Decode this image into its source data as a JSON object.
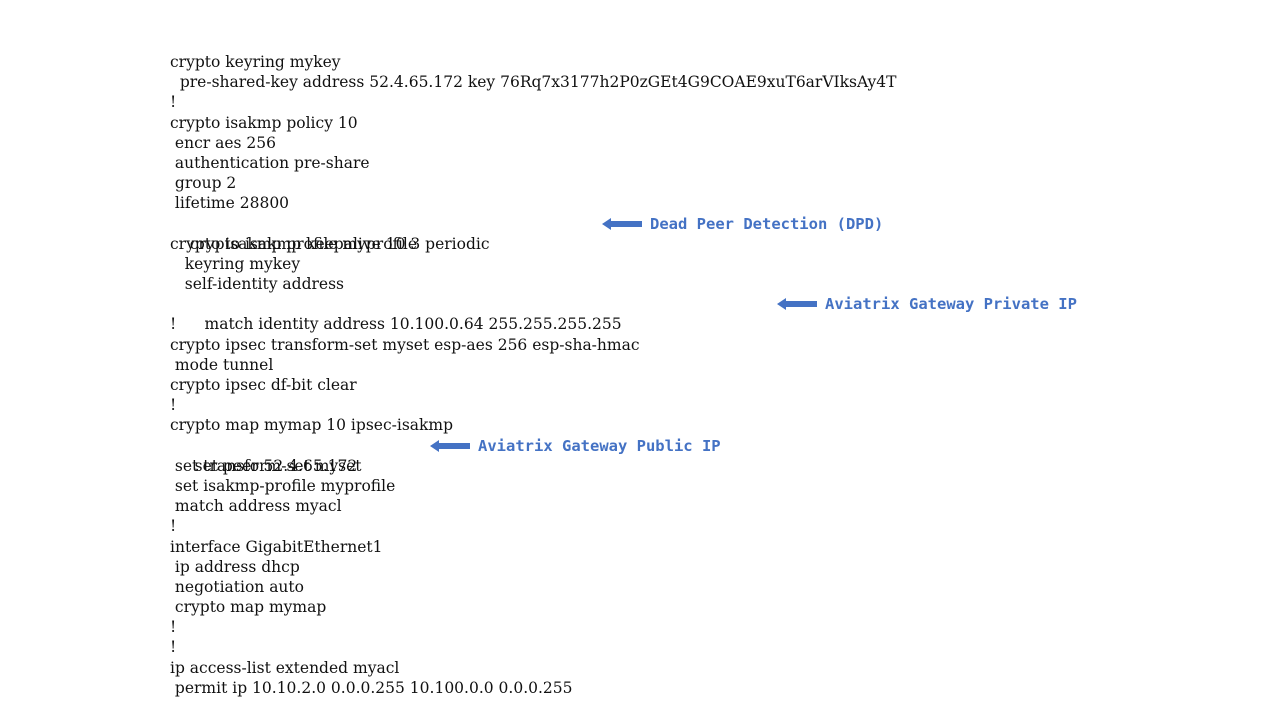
{
  "lines": [
    "crypto keyring mykey",
    "  pre-shared-key address 52.4.65.172 key 76Rq7x3177h2P0zGEt4G9COAE9xuT6arVIksAy4T",
    "!",
    "crypto isakmp policy 10",
    " encr aes 256",
    " authentication pre-share",
    " group 2",
    " lifetime 28800",
    "crypto isakmp keepalive 10 3 periodic",
    "crypto isakmp profile myprofile",
    "   keyring mykey",
    "   self-identity address",
    "   match identity address 10.100.0.64 255.255.255.255",
    "!",
    "crypto ipsec transform-set myset esp-aes 256 esp-sha-hmac",
    " mode tunnel",
    "crypto ipsec df-bit clear",
    "!",
    "crypto map mymap 10 ipsec-isakmp",
    " set peer 52.4.65.172",
    " set transform-set myset",
    " set isakmp-profile myprofile",
    " match address myacl",
    "!",
    "interface GigabitEthernet1",
    " ip address dhcp",
    " negotiation auto",
    " crypto map mymap",
    "!",
    "!",
    "ip access-list extended myacl",
    " permit ip 10.10.2.0 0.0.0.255 10.100.0.0 0.0.0.255"
  ],
  "annotations": {
    "dpd": "Dead Peer Detection (DPD)",
    "private_ip": "Aviatrix Gateway Private IP",
    "public_ip": "Aviatrix Gateway Public IP"
  },
  "colors": {
    "annotation": "#4472C4",
    "text": "#111111"
  }
}
